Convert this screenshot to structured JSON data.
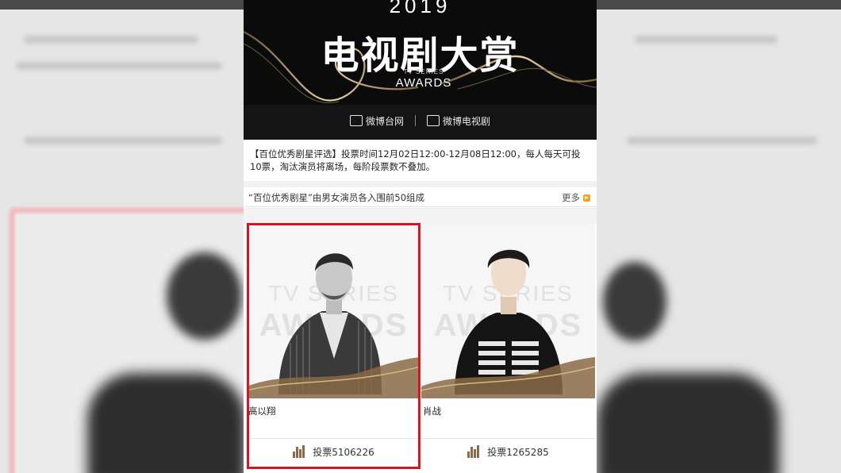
{
  "banner": {
    "year": "2019",
    "title": "电视剧大赏",
    "subtitle_small": "TV SERIES",
    "subtitle_large": "AWARDS",
    "logos": [
      {
        "label": "微博台网",
        "icon": "weibo-tv-network-logo"
      },
      {
        "label": "微博电视剧",
        "icon": "weibo-tv-series-logo"
      }
    ]
  },
  "notice": "【百位优秀剧星评选】投票时间12月02日12:00-12月08日12:00，每人每天可投10票，淘汰演员将离场，每阶段票数不叠加。",
  "section": {
    "title": "“百位优秀剧星”由男女演员各入围前50组成",
    "more_label": "更多",
    "more_icon": "chevron-right-icon"
  },
  "watermark": {
    "line1": "TV SERIES",
    "line2": "AWARDS"
  },
  "cards": [
    {
      "name": "高以翔",
      "votes_label": "投票5106226",
      "votes": 5106226,
      "icon": "vote-bars-icon",
      "highlighted": true
    },
    {
      "name": "肖战",
      "votes_label": "投票1265285",
      "votes": 1265285,
      "icon": "vote-bars-icon",
      "highlighted": false
    }
  ],
  "colors": {
    "highlight": "#d7141f",
    "more_accent": "#f7a21b",
    "banner_bg": "#0b0b0b",
    "gold": "#b8956a"
  }
}
